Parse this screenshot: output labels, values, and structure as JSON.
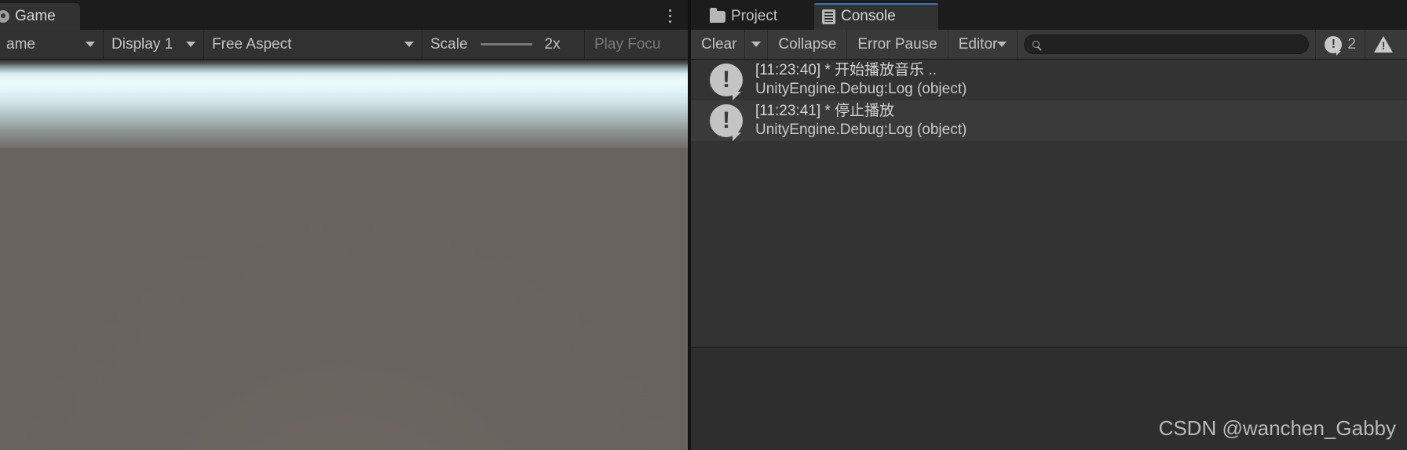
{
  "game_panel": {
    "tab": {
      "label": "Game",
      "icon": "game-view-icon"
    },
    "menu_icon": "kebab-menu-icon",
    "toolbar": {
      "mode": {
        "label": "ame",
        "icon": "chevron-down-icon"
      },
      "display": {
        "label": "Display 1",
        "icon": "chevron-down-icon"
      },
      "aspect": {
        "label": "Free Aspect",
        "icon": "chevron-down-icon"
      },
      "scale": {
        "label": "Scale",
        "value": "2x"
      },
      "play_focused": {
        "label": "Play Focu"
      }
    },
    "viewport": {
      "sky_top_color": "#2b2c2d",
      "horizon_color": "#eefbfd",
      "ground_color": "#69635f"
    }
  },
  "console_panel": {
    "tabs": [
      {
        "label": "Project",
        "icon": "folder-icon",
        "active": false
      },
      {
        "label": "Console",
        "icon": "console-icon",
        "active": true
      }
    ],
    "toolbar": {
      "clear": "Clear",
      "clear_dropdown_icon": "chevron-down-icon",
      "collapse": "Collapse",
      "error_pause": "Error Pause",
      "editor": "Editor",
      "editor_dropdown_icon": "chevron-down-icon",
      "search": {
        "value": "",
        "placeholder": "",
        "icon": "search-icon"
      },
      "error_count": "2",
      "error_icon": "error-badge-icon",
      "warning_count": "",
      "warning_icon": "warning-badge-icon"
    },
    "logs": [
      {
        "icon": "log-info-icon",
        "message": "[11:23:40] * 开始播放音乐 ..",
        "stack": "UnityEngine.Debug:Log (object)"
      },
      {
        "icon": "log-info-icon",
        "message": "[11:23:41] * 停止播放",
        "stack": "UnityEngine.Debug:Log (object)"
      }
    ],
    "detail": {
      "text": ""
    }
  },
  "watermark": "CSDN @wanchen_Gabby",
  "accent_color": "#3a72b0"
}
